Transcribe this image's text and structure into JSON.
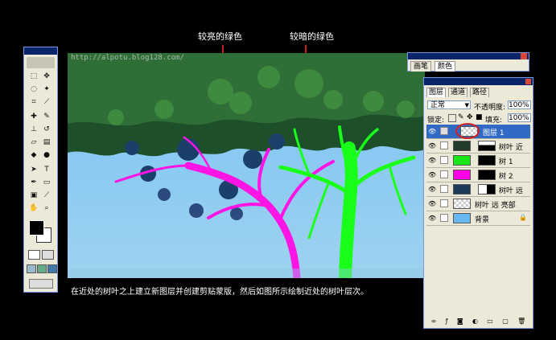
{
  "annotations": {
    "left_label": "较亮的绿色",
    "right_label": "较暗的绿色"
  },
  "watermark": "http://alpotu.blog128.com/",
  "caption": "在近处的树叶之上建立新图层并创建剪贴蒙版，然后如图所示绘制近处的树叶层次。",
  "mini_palette": {
    "tabs": [
      "画笔",
      "颜色"
    ]
  },
  "layers_panel": {
    "tabs": [
      "图层",
      "通道",
      "路径"
    ],
    "blend_mode": "正常",
    "opacity_label": "不透明度:",
    "opacity_value": "100%",
    "lock_label": "锁定:",
    "fill_label": "填充:",
    "fill_value": "100%",
    "layers": [
      {
        "name": "图层 1",
        "selected": true,
        "thumb": "transparent"
      },
      {
        "name": "树叶 近",
        "selected": false,
        "thumb": "leaves"
      },
      {
        "name": "树 1",
        "selected": false,
        "thumb": "#19e619"
      },
      {
        "name": "树 2",
        "selected": false,
        "thumb": "#ff00e6"
      },
      {
        "name": "树叶 远",
        "selected": false,
        "thumb": "leaves"
      },
      {
        "name": "树叶 远 亮部",
        "selected": false,
        "thumb": "transparent"
      },
      {
        "name": "背景",
        "selected": false,
        "thumb": "#6ab8f0"
      }
    ]
  },
  "colors": {
    "sky": "#7fc6f2",
    "dark_green": "#1f5a2a",
    "mid_green": "#3b7d3a",
    "bright_green": "#19ff19",
    "magenta": "#ff14e6",
    "selection_blue": "#316ac5",
    "annotation_red": "#c8201a"
  }
}
